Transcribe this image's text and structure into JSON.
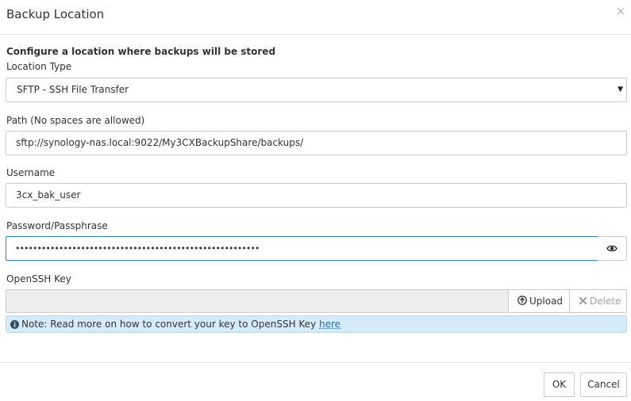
{
  "dialog": {
    "title": "Backup Location",
    "close_label": "×"
  },
  "form": {
    "heading": "Configure a location where backups will be stored",
    "location_type": {
      "label": "Location Type",
      "selected": "SFTP - SSH File Transfer"
    },
    "path": {
      "label": "Path (No spaces are allowed)",
      "value": "sftp://synology-nas.local:9022/My3CXBackupShare/backups/"
    },
    "username": {
      "label": "Username",
      "value": "3cx_bak_user"
    },
    "password": {
      "label": "Password/Passphrase",
      "value": "••••••••••••••••••••••••••••••••••••••••••••••••••••••••"
    },
    "openssh_key": {
      "label": "OpenSSH Key",
      "upload_label": "Upload",
      "delete_label": "Delete"
    },
    "note": {
      "text": "Note: Read more on how to convert your key to OpenSSH Key",
      "link_text": "here"
    }
  },
  "footer": {
    "ok_label": "OK",
    "cancel_label": "Cancel"
  },
  "icons": {
    "close": "close-icon",
    "dropdown": "caret-down-icon",
    "reveal": "eye-icon",
    "upload": "upload-circle-icon",
    "delete": "x-icon",
    "info": "info-circle-icon"
  },
  "colors": {
    "focus_border": "#2b7fb8",
    "note_background": "#d6ebf9",
    "link": "#2a6da4",
    "disabled_text": "#a0a0a0"
  }
}
